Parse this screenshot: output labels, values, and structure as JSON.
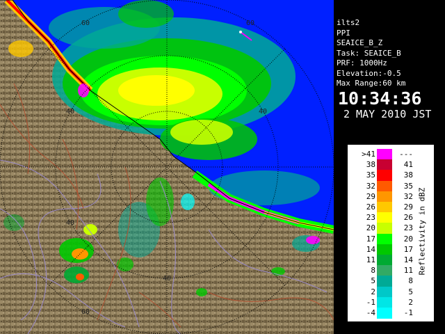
{
  "info": {
    "station": "ilts2",
    "mode": "PPI",
    "product": "SEAICE_B_Z",
    "task": "Task: SEAICE_B",
    "prf": "PRF: 1000Hz",
    "elevation": "Elevation:-0.5",
    "max_range": "Max Range:60 km",
    "time": "10:34:36",
    "date": "2 MAY 2010 JST"
  },
  "range_rings": {
    "labels_top": [
      "60",
      "60"
    ],
    "labels_mid": [
      "40",
      "40"
    ],
    "labels_bottom": [
      "40",
      "40",
      "60"
    ]
  },
  "legend": {
    "title": "Reflectivity in dBZ",
    "rows": [
      {
        "lo": ">41",
        "hi": "---",
        "color": "#ff00ff"
      },
      {
        "lo": "38",
        "hi": "41",
        "color": "#c80032"
      },
      {
        "lo": "35",
        "hi": "38",
        "color": "#ff0000"
      },
      {
        "lo": "32",
        "hi": "35",
        "color": "#ff5a00"
      },
      {
        "lo": "29",
        "hi": "32",
        "color": "#ff9600"
      },
      {
        "lo": "26",
        "hi": "29",
        "color": "#ffc800"
      },
      {
        "lo": "23",
        "hi": "26",
        "color": "#ffff00"
      },
      {
        "lo": "20",
        "hi": "23",
        "color": "#c8ff00"
      },
      {
        "lo": "17",
        "hi": "20",
        "color": "#00ff00"
      },
      {
        "lo": "14",
        "hi": "17",
        "color": "#00c800"
      },
      {
        "lo": "11",
        "hi": "14",
        "color": "#00aa32"
      },
      {
        "lo": "8",
        "hi": "11",
        "color": "#32aa64"
      },
      {
        "lo": "5",
        "hi": "8",
        "color": "#00aa96"
      },
      {
        "lo": "2",
        "hi": "5",
        "color": "#00c8c8"
      },
      {
        "lo": "-1",
        "hi": "2",
        "color": "#00e6e6"
      },
      {
        "lo": "-4",
        "hi": "-1",
        "color": "#00ffff"
      }
    ]
  },
  "colors": {
    "sea": "#0020ff",
    "land": "#8a7a58",
    "border": "#9a8acb",
    "river": "#b05030",
    "background": "#000000"
  }
}
